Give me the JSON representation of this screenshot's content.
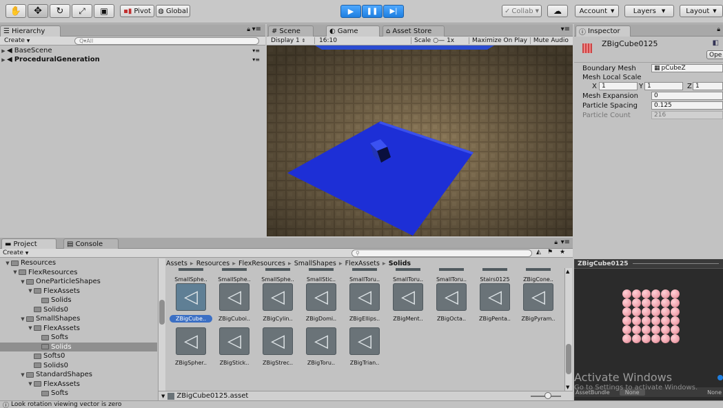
{
  "toolbar": {
    "tools": [
      "hand-tool",
      "move-tool",
      "rotate-tool",
      "scale-tool",
      "rect-tool"
    ],
    "pivot_label": "Pivot",
    "global_label": "Global",
    "collab_label": "Collab",
    "account_label": "Account",
    "layers_label": "Layers",
    "layout_label": "Layout"
  },
  "hierarchy": {
    "tab_label": "Hierarchy",
    "create_label": "Create",
    "search_placeholder": "Q▾All",
    "items": [
      {
        "label": "BaseScene"
      },
      {
        "label": "ProceduralGeneration"
      }
    ]
  },
  "scene_tabs": {
    "scene": "Scene",
    "game": "Game",
    "asset_store": "Asset Store"
  },
  "game_bar": {
    "display": "Display 1",
    "aspect": "16:10",
    "scale_label": "Scale",
    "scale_value": "1x",
    "maximize": "Maximize On Play",
    "mute": "Mute Audio"
  },
  "inspector": {
    "tab_label": "Inspector",
    "object_name": "ZBigCube0125",
    "open_label": "Ope",
    "rows": {
      "boundary_mesh_label": "Boundary Mesh",
      "boundary_mesh_value": "pCubeZ",
      "mesh_local_scale_label": "Mesh Local Scale",
      "x_label": "X",
      "x_value": "1",
      "y_label": "Y",
      "y_value": "1",
      "z_label": "Z",
      "z_value": "1",
      "mesh_expansion_label": "Mesh Expansion",
      "mesh_expansion_value": "0",
      "particle_spacing_label": "Particle Spacing",
      "particle_spacing_value": "0.125",
      "particle_count_label": "Particle Count",
      "particle_count_value": "216"
    }
  },
  "project": {
    "tab_label": "Project",
    "console_label": "Console",
    "create_label": "Create",
    "tree": [
      {
        "label": "Resources",
        "depth": 0,
        "expanded": true
      },
      {
        "label": "FlexResources",
        "depth": 1,
        "expanded": true
      },
      {
        "label": "OneParticleShapes",
        "depth": 2,
        "expanded": true
      },
      {
        "label": "FlexAssets",
        "depth": 3,
        "expanded": true
      },
      {
        "label": "Solids",
        "depth": 4,
        "expanded": false
      },
      {
        "label": "Solids0",
        "depth": 3,
        "expanded": false
      },
      {
        "label": "SmallShapes",
        "depth": 2,
        "expanded": true
      },
      {
        "label": "FlexAssets",
        "depth": 3,
        "expanded": true
      },
      {
        "label": "Softs",
        "depth": 4,
        "expanded": false
      },
      {
        "label": "Solids",
        "depth": 4,
        "expanded": false,
        "selected": true
      },
      {
        "label": "Softs0",
        "depth": 3,
        "expanded": false
      },
      {
        "label": "Solids0",
        "depth": 3,
        "expanded": false
      },
      {
        "label": "StandardShapes",
        "depth": 2,
        "expanded": true
      },
      {
        "label": "FlexAssets",
        "depth": 3,
        "expanded": true
      },
      {
        "label": "Softs",
        "depth": 4,
        "expanded": false
      }
    ],
    "breadcrumb": [
      "Assets",
      "Resources",
      "FlexResources",
      "SmallShapes",
      "FlexAssets",
      "Solids"
    ],
    "top_row": [
      "SmallSphe..",
      "SmallSphe..",
      "SmallSphe..",
      "SmallStic..",
      "SmallToru..",
      "SmallToru..",
      "SmallToru..",
      "Stairs0125",
      "ZBigCone.."
    ],
    "row2": [
      "ZBigCube..",
      "ZBigCuboi..",
      "ZBigCylin..",
      "ZBigDomi..",
      "ZBigEllips..",
      "ZBigMent..",
      "ZBigOcta..",
      "ZBigPenta..",
      "ZBigPyram.."
    ],
    "row3": [
      "ZBigSpher..",
      "ZBigStick..",
      "ZBigStrec..",
      "ZBigToru..",
      "ZBigTrian.."
    ],
    "selected_file": "ZBigCube0125.asset"
  },
  "preview": {
    "title": "ZBigCube0125",
    "bundle_label": "AssetBundle",
    "bundle_value": "None",
    "bundle_value2": "None"
  },
  "watermark": {
    "line1": "Activate Windows",
    "line2": "Go to Settings to activate Windows."
  },
  "status": {
    "message": "Look rotation viewing vector is zero"
  },
  "colors": {
    "play_blue": "#1f7fe0",
    "plane_blue": "#1d2fd6",
    "selection_blue": "#3b6fc4",
    "particle_pink": "#f0a4ae"
  }
}
